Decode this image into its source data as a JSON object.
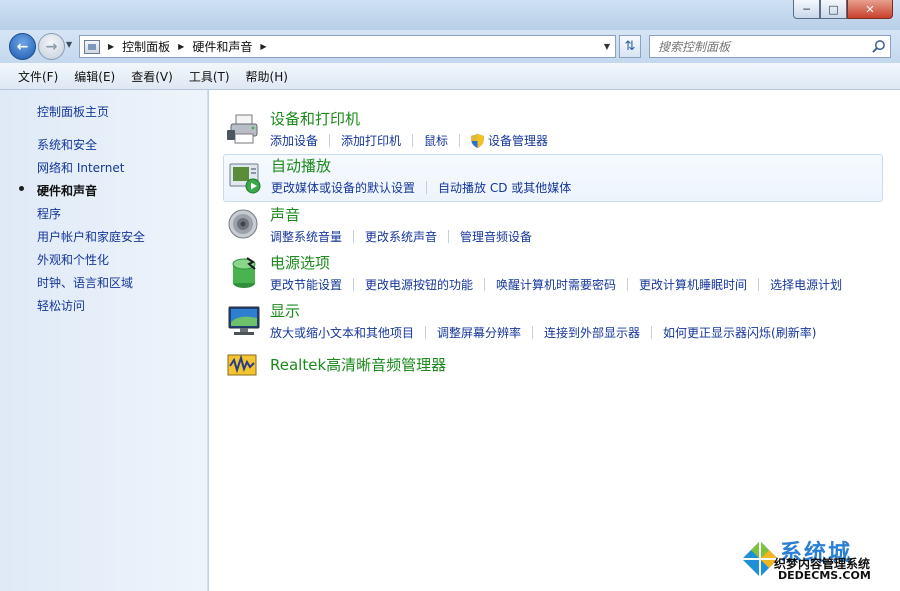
{
  "window": {
    "controls": [
      "minimize",
      "maximize",
      "close"
    ]
  },
  "nav": {
    "breadcrumb": [
      "控制面板",
      "硬件和声音"
    ],
    "search_placeholder": "搜索控制面板"
  },
  "menu": [
    "文件(F)",
    "编辑(E)",
    "查看(V)",
    "工具(T)",
    "帮助(H)"
  ],
  "sidebar": {
    "items": [
      {
        "label": "控制面板主页",
        "current": false
      },
      {
        "label": "系统和安全",
        "current": false
      },
      {
        "label": "网络和 Internet",
        "current": false
      },
      {
        "label": "硬件和声音",
        "current": true
      },
      {
        "label": "程序",
        "current": false
      },
      {
        "label": "用户帐户和家庭安全",
        "current": false
      },
      {
        "label": "外观和个性化",
        "current": false
      },
      {
        "label": "时钟、语言和区域",
        "current": false
      },
      {
        "label": "轻松访问",
        "current": false
      }
    ]
  },
  "categories": [
    {
      "title": "设备和打印机",
      "icon": "printer-icon",
      "links": [
        "添加设备",
        "添加打印机",
        "鼠标",
        "设备管理器"
      ]
    },
    {
      "title": "自动播放",
      "icon": "autoplay-icon",
      "links": [
        "更改媒体或设备的默认设置",
        "自动播放 CD 或其他媒体"
      ]
    },
    {
      "title": "声音",
      "icon": "speaker-icon",
      "links": [
        "调整系统音量",
        "更改系统声音",
        "管理音频设备"
      ]
    },
    {
      "title": "电源选项",
      "icon": "battery-icon",
      "links": [
        "更改节能设置",
        "更改电源按钮的功能",
        "唤醒计算机时需要密码",
        "更改计算机睡眠时间",
        "选择电源计划"
      ]
    },
    {
      "title": "显示",
      "icon": "monitor-icon",
      "links": [
        "放大或缩小文本和其他项目",
        "调整屏幕分辨率",
        "连接到外部显示器",
        "如何更正显示器闪烁(刷新率)"
      ]
    },
    {
      "title": "Realtek高清晰音频管理器",
      "icon": "realtek-audio-icon",
      "links": []
    }
  ],
  "watermark": {
    "main": "系统城",
    "sub1": "织梦内容管理系统",
    "sub2": "DEDECMS.COM"
  },
  "colors": {
    "link": "#15379a",
    "category_title": "#1b8a1b",
    "sidebar_bg": "#dfeaf7"
  }
}
